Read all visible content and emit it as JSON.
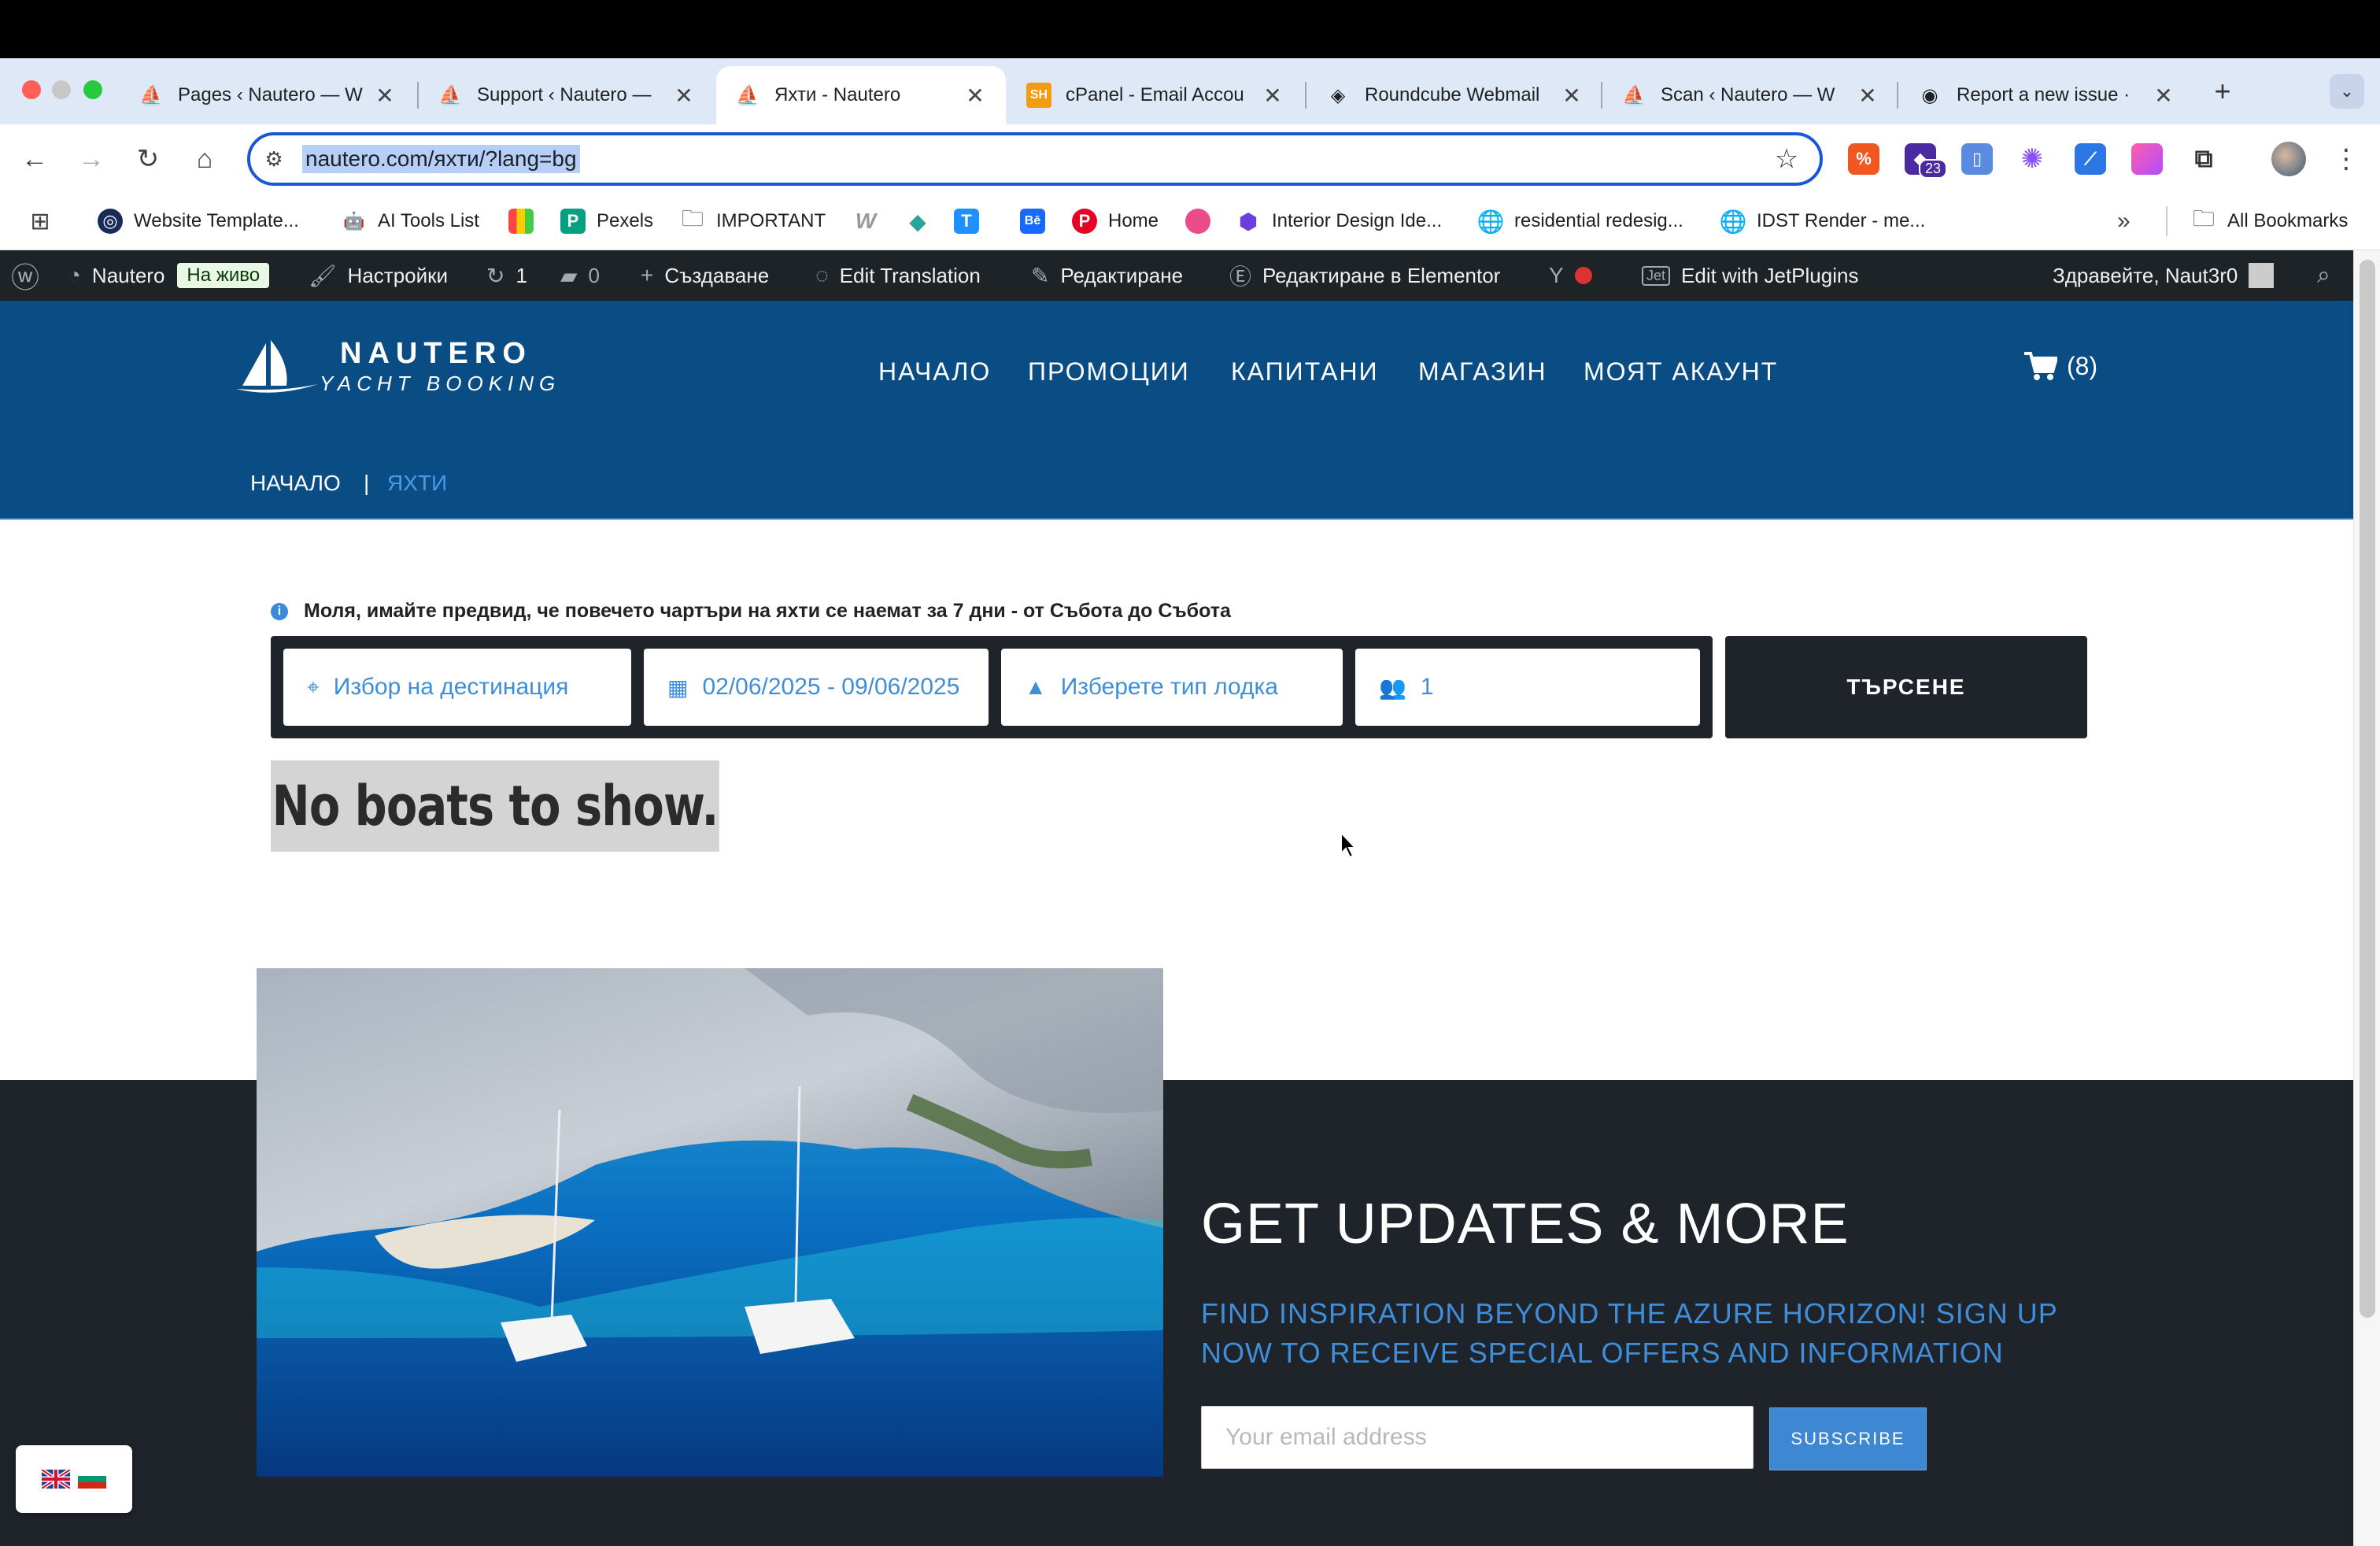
{
  "browser": {
    "tabs": [
      {
        "title": "Pages ‹ Nautero — W",
        "icon": "sailboat-icon"
      },
      {
        "title": "Support ‹ Nautero —",
        "icon": "sailboat-icon"
      },
      {
        "title": "Яхти - Nautero",
        "icon": "sailboat-icon",
        "active": true
      },
      {
        "title": "cPanel - Email Accou",
        "icon": "sh-icon"
      },
      {
        "title": "Roundcube Webmail",
        "icon": "roundcube-icon"
      },
      {
        "title": "Scan ‹ Nautero — W",
        "icon": "sailboat-icon"
      },
      {
        "title": "Report a new issue ·",
        "icon": "github-icon"
      }
    ],
    "new_tab": "+",
    "tab_close": "✕",
    "url": "nautero.com/яхти/?lang=bg",
    "ext_badge": "23",
    "bookmarks": [
      {
        "label": "Website Template...",
        "icon": "globe-icon"
      },
      {
        "label": "AI Tools List",
        "icon": "robot-icon"
      },
      {
        "label": "",
        "icon": "color-grid-icon"
      },
      {
        "label": "Pexels",
        "icon": "pexels-icon"
      },
      {
        "label": "IMPORTANT",
        "icon": "folder-icon"
      },
      {
        "label": "",
        "icon": "w-icon"
      },
      {
        "label": "",
        "icon": "tag-icon"
      },
      {
        "label": "",
        "icon": "t-icon"
      },
      {
        "label": "",
        "icon": "behance-icon"
      },
      {
        "label": "Home",
        "icon": "pinterest-icon"
      },
      {
        "label": "",
        "icon": "dribbble-icon"
      },
      {
        "label": "Interior Design Ide...",
        "icon": "cube-icon"
      },
      {
        "label": "residential redesig...",
        "icon": "globe-icon"
      },
      {
        "label": "IDST Render - me...",
        "icon": "globe-icon"
      }
    ],
    "more_bookmarks": "»",
    "all_bookmarks": "All Bookmarks"
  },
  "wp_admin": {
    "site_name": "Nautero",
    "live_badge": "На живо",
    "settings": "Настройки",
    "updates_count": "1",
    "comments_count": "0",
    "create": "Създаване",
    "edit_translation": "Edit Translation",
    "edit": "Редактиране",
    "edit_elementor": "Редактиране в Elementor",
    "jetplugins": "Edit with JetPlugins",
    "greeting": "Здравейте, Naut3r0"
  },
  "site": {
    "logo_line1": "NAUTERO",
    "logo_line2": "YACHT BOOKING",
    "menu": [
      "НАЧАЛО",
      "ПРОМОЦИИ",
      "КАПИТАНИ",
      "МАГАЗИН",
      "МОЯТ АКАУНТ"
    ],
    "cart_count": "(8)",
    "breadcrumb": {
      "home": "НАЧАЛО",
      "separator": "|",
      "current": "ЯХТИ"
    }
  },
  "search": {
    "notice": "Моля, имайте предвид, че повечето чартъри на яхти се наемат за 7 дни - от Събота до Събота",
    "destination_placeholder": "Избор на дестинация",
    "dates": "02/06/2025 - 09/06/2025",
    "boat_type_placeholder": "Изберете тип лодка",
    "guests": "1",
    "button": "ТЪРСЕНЕ"
  },
  "results": {
    "empty_message": "No boats to show."
  },
  "newsletter": {
    "title": "GET UPDATES & MORE",
    "subtitle": "FIND INSPIRATION BEYOND THE AZURE HORIZON! SIGN UP NOW TO RECEIVE SPECIAL OFFERS AND INFORMATION",
    "email_placeholder": "Your email address",
    "button": "SUBSCRIBE"
  },
  "colors": {
    "header_blue": "#0a4d85",
    "accent_blue": "#3f8ed9",
    "dark": "#1f232a",
    "wp_bar": "#1d2327"
  }
}
